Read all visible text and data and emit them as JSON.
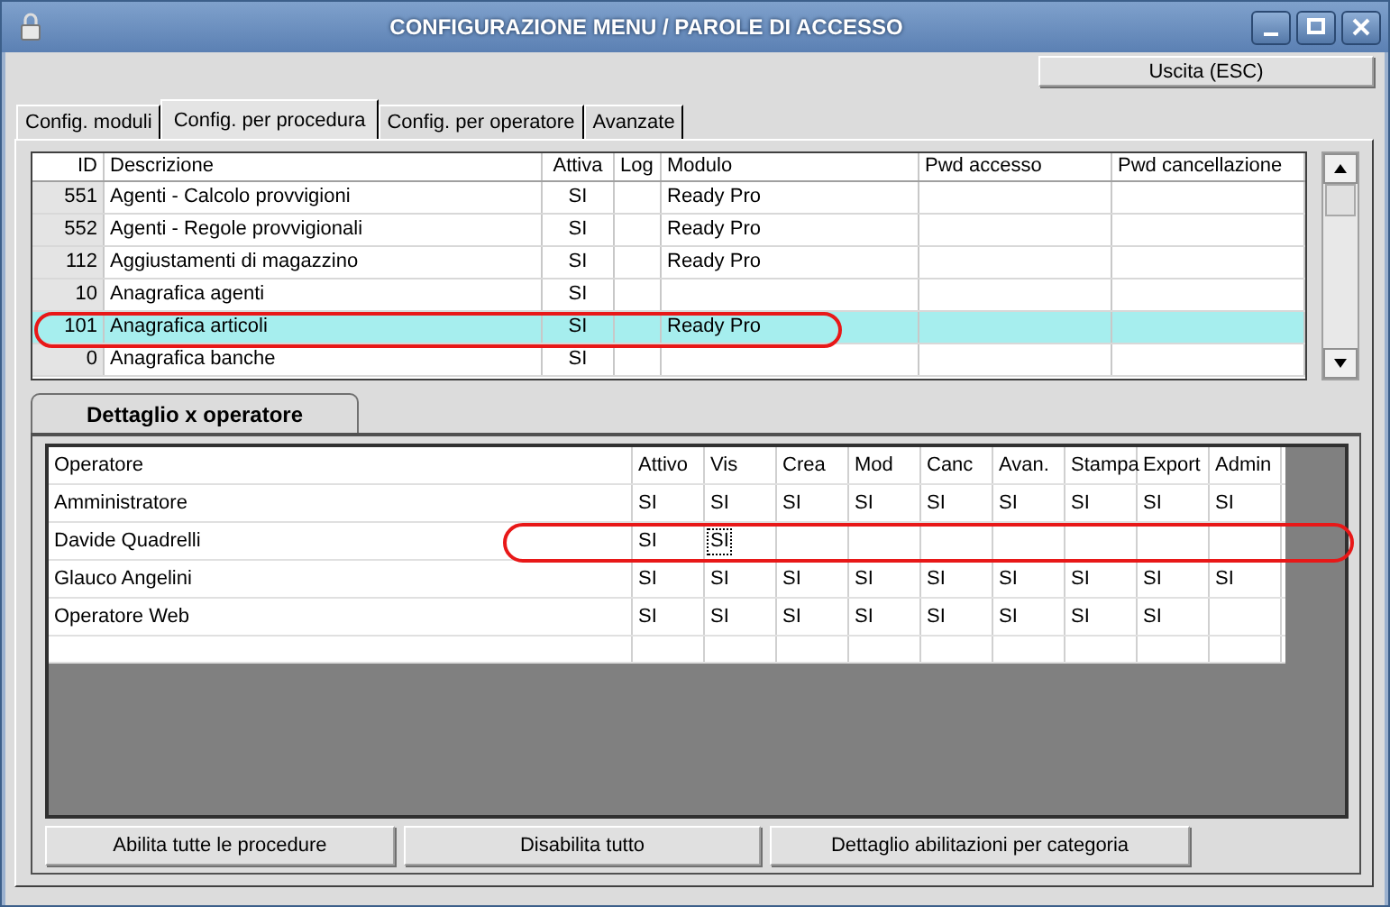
{
  "window": {
    "title": "CONFIGURAZIONE MENU / PAROLE DI ACCESSO"
  },
  "exit_button": "Uscita (ESC)",
  "tabs": [
    {
      "label": "Config. moduli",
      "selected": false
    },
    {
      "label": "Config. per procedura",
      "selected": true
    },
    {
      "label": "Config. per operatore",
      "selected": false
    },
    {
      "label": "Avanzate",
      "selected": false
    }
  ],
  "procedures": {
    "columns": [
      "ID",
      "Descrizione",
      "Attiva",
      "Log",
      "Modulo",
      "Pwd accesso",
      "Pwd cancellazione"
    ],
    "rows": [
      {
        "id": "551",
        "description": "Agenti - Calcolo provvigioni",
        "active": "SI",
        "module": "Ready Pro",
        "selected": false
      },
      {
        "id": "552",
        "description": "Agenti - Regole provvigionali",
        "active": "SI",
        "module": "Ready Pro",
        "selected": false
      },
      {
        "id": "112",
        "description": "Aggiustamenti di magazzino",
        "active": "SI",
        "module": "Ready Pro",
        "selected": false
      },
      {
        "id": "10",
        "description": "Anagrafica agenti",
        "active": "SI",
        "selected": false
      },
      {
        "id": "101",
        "description": "Anagrafica articoli",
        "active": "SI",
        "module": "Ready Pro",
        "selected": true
      },
      {
        "id": "0",
        "description": "Anagrafica banche",
        "active": "SI",
        "selected": false
      }
    ]
  },
  "detail_tab": "Dettaglio x operatore",
  "operators": {
    "name_column": "Operatore",
    "columns": [
      "Attivo",
      "Vis",
      "Crea",
      "Mod",
      "Canc",
      "Avan.",
      "Stampa",
      "Export",
      "Admin"
    ],
    "rows": [
      {
        "name": "Amministratore",
        "cells": [
          {
            "value": "SI",
            "focused": false
          },
          {
            "value": "SI",
            "focused": false
          },
          {
            "value": "SI",
            "focused": false
          },
          {
            "value": "SI",
            "focused": false
          },
          {
            "value": "SI",
            "focused": false
          },
          {
            "value": "SI",
            "focused": false
          },
          {
            "value": "SI",
            "focused": false
          },
          {
            "value": "SI",
            "focused": false
          },
          {
            "value": "SI",
            "focused": false
          }
        ]
      },
      {
        "name": "Davide Quadrelli",
        "cells": [
          {
            "value": "SI",
            "focused": false
          },
          {
            "value": "SI",
            "focused": true
          },
          null,
          null,
          null,
          null,
          null,
          null,
          null
        ]
      },
      {
        "name": "Glauco Angelini",
        "cells": [
          {
            "value": "SI",
            "focused": false
          },
          {
            "value": "SI",
            "focused": false
          },
          {
            "value": "SI",
            "focused": false
          },
          {
            "value": "SI",
            "focused": false
          },
          {
            "value": "SI",
            "focused": false
          },
          {
            "value": "SI",
            "focused": false
          },
          {
            "value": "SI",
            "focused": false
          },
          {
            "value": "SI",
            "focused": false
          },
          {
            "value": "SI",
            "focused": false
          }
        ]
      },
      {
        "name": "Operatore Web",
        "cells": [
          {
            "value": "SI",
            "focused": false
          },
          {
            "value": "SI",
            "focused": false
          },
          {
            "value": "SI",
            "focused": false
          },
          {
            "value": "SI",
            "focused": false
          },
          {
            "value": "SI",
            "focused": false
          },
          {
            "value": "SI",
            "focused": false
          },
          {
            "value": "SI",
            "focused": false
          },
          {
            "value": "SI",
            "focused": false
          },
          null
        ]
      }
    ]
  },
  "buttons": [
    "Abilita tutte le procedure",
    "Disabilita tutto",
    "Dettaglio abilitazioni per categoria"
  ]
}
